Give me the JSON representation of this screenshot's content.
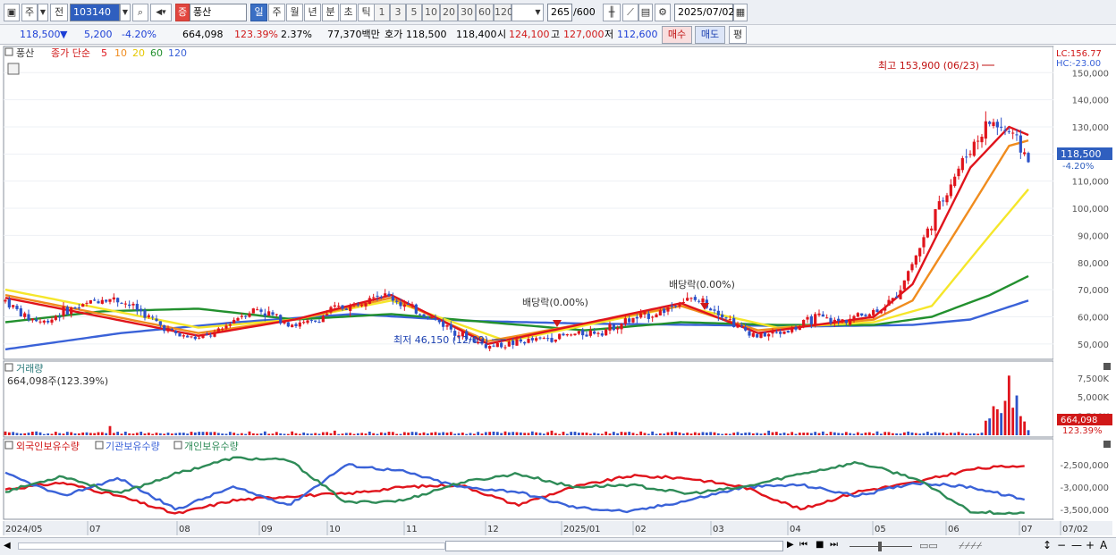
{
  "toolbar": {
    "type_label": "주",
    "all_label": "전",
    "code": "103140",
    "stock_badge": "증",
    "stock_name": "풍산",
    "periods": [
      "일",
      "주",
      "월",
      "년",
      "분",
      "초",
      "틱"
    ],
    "minute_units": [
      "1",
      "3",
      "5",
      "10",
      "20",
      "30",
      "60",
      "120"
    ],
    "count": "265",
    "count_total": "/600",
    "date": "2025/07/02"
  },
  "quote": {
    "price": "118,500",
    "change_arrow": "▼",
    "change": "5,200",
    "change_pct": "-4.20%",
    "volume": "664,098",
    "volume_ratio": "123.39%",
    "turnover": "2.37%",
    "amount": "77,370백만",
    "bid_label": "호가",
    "ask_price": "118,500",
    "bid_price": "118,400",
    "open_label": "시",
    "open": "124,100",
    "high_label": "고",
    "high": "127,000",
    "low_label": "저",
    "low": "112,600",
    "buy_label": "매수",
    "sell_label": "매도",
    "eval_label": "평"
  },
  "price_panel": {
    "stock_tag": "풍산",
    "ma_title": "종가 단순",
    "ma_periods": [
      "5",
      "10",
      "20",
      "60",
      "120"
    ],
    "lc_label": "LC:156.77",
    "hc_label": "HC:-23.00",
    "current_price_label": "118,500",
    "current_change_label": "-4.20%",
    "annotation_high": "최고 153,900 (06/23)",
    "annotation_low": "최저 46,150 (12/09)",
    "annotation_div1": "배당락(0.00%)",
    "annotation_div2": "배당락(0.00%)"
  },
  "volume_panel": {
    "title": "거래량",
    "value_label": "664,098주(123.39%)",
    "current_label": "664,098",
    "ratio_label": "123.39%"
  },
  "holding_panel": {
    "series_labels": [
      "외국인보유수량",
      "기관보유수량",
      "개인보유수량"
    ]
  },
  "date_axis": [
    "2024/05",
    "07",
    "08",
    "09",
    "10",
    "11",
    "12",
    "2025/01",
    "02",
    "03",
    "04",
    "05",
    "06",
    "07",
    "07/02"
  ],
  "colors": {
    "ma5": "#e0141c",
    "ma10": "#f08c1e",
    "ma20": "#f5e62a",
    "ma60": "#22902e",
    "ma120": "#3a62d8",
    "up": "#e0141c",
    "down": "#2c52c8",
    "foreign": "#e0141c",
    "institution": "#3a62d8",
    "individual": "#2e8b57"
  },
  "chart_data": [
    {
      "type": "candlestick",
      "title": "풍산",
      "x": [
        "2024/05",
        "07",
        "08",
        "09",
        "10",
        "11",
        "12",
        "2025/01",
        "02",
        "03",
        "04",
        "05",
        "06",
        "07"
      ],
      "y_ticks": [
        50000,
        60000,
        70000,
        80000,
        90000,
        100000,
        110000,
        120000,
        130000,
        140000,
        150000
      ],
      "ylim": [
        45000,
        157000
      ],
      "close_path": [
        [
          0,
          66000
        ],
        [
          1,
          60000
        ],
        [
          2,
          58000
        ],
        [
          3,
          62000
        ],
        [
          4,
          64000
        ],
        [
          5,
          67000
        ],
        [
          6,
          66000
        ],
        [
          7,
          62000
        ],
        [
          8,
          57000
        ],
        [
          9,
          53000
        ],
        [
          10,
          52000
        ],
        [
          11,
          54000
        ],
        [
          12,
          60000
        ],
        [
          13,
          63000
        ],
        [
          14,
          60000
        ],
        [
          15,
          57000
        ],
        [
          16,
          58000
        ],
        [
          17,
          63000
        ],
        [
          18,
          64000
        ],
        [
          19,
          69000
        ],
        [
          20,
          67000
        ],
        [
          21,
          63000
        ],
        [
          22,
          60000
        ],
        [
          23,
          56000
        ],
        [
          24,
          52000
        ],
        [
          25,
          49000
        ],
        [
          26,
          50000
        ],
        [
          27,
          51000
        ],
        [
          28,
          52000
        ],
        [
          29,
          53000
        ],
        [
          30,
          54000
        ],
        [
          31,
          55000
        ],
        [
          32,
          58000
        ],
        [
          33,
          60000
        ],
        [
          34,
          62000
        ],
        [
          35,
          66000
        ],
        [
          36,
          66000
        ],
        [
          37,
          62000
        ],
        [
          38,
          56000
        ],
        [
          39,
          53000
        ],
        [
          40,
          54000
        ],
        [
          41,
          56000
        ],
        [
          42,
          60000
        ],
        [
          43,
          58000
        ],
        [
          44,
          60000
        ],
        [
          45,
          62000
        ],
        [
          46,
          66000
        ],
        [
          47,
          80000
        ],
        [
          48,
          95000
        ],
        [
          49,
          110000
        ],
        [
          50,
          122000
        ],
        [
          51,
          132000
        ],
        [
          52,
          128000
        ],
        [
          53,
          118500
        ]
      ],
      "ma": {
        "5": [
          [
            0,
            67000
          ],
          [
            10,
            53000
          ],
          [
            15,
            59000
          ],
          [
            20,
            68000
          ],
          [
            25,
            50000
          ],
          [
            35,
            65000
          ],
          [
            39,
            54000
          ],
          [
            45,
            60000
          ],
          [
            47,
            72000
          ],
          [
            50,
            115000
          ],
          [
            52,
            130000
          ],
          [
            53,
            127000
          ]
        ],
        "10": [
          [
            0,
            68000
          ],
          [
            10,
            54000
          ],
          [
            15,
            59000
          ],
          [
            20,
            67000
          ],
          [
            25,
            51000
          ],
          [
            35,
            64000
          ],
          [
            39,
            55000
          ],
          [
            45,
            59000
          ],
          [
            47,
            66000
          ],
          [
            50,
            100000
          ],
          [
            52,
            123000
          ],
          [
            53,
            125000
          ]
        ],
        "20": [
          [
            0,
            70000
          ],
          [
            10,
            56000
          ],
          [
            15,
            59000
          ],
          [
            20,
            66000
          ],
          [
            26,
            51000
          ],
          [
            35,
            64000
          ],
          [
            40,
            56000
          ],
          [
            45,
            58000
          ],
          [
            48,
            64000
          ],
          [
            51,
            90000
          ],
          [
            53,
            107000
          ]
        ],
        "60": [
          [
            0,
            58000
          ],
          [
            5,
            62000
          ],
          [
            10,
            63000
          ],
          [
            15,
            59000
          ],
          [
            20,
            61000
          ],
          [
            25,
            58000
          ],
          [
            30,
            55000
          ],
          [
            35,
            58000
          ],
          [
            40,
            57000
          ],
          [
            45,
            57000
          ],
          [
            48,
            60000
          ],
          [
            51,
            68000
          ],
          [
            53,
            75000
          ]
        ],
        "120": [
          [
            0,
            48000
          ],
          [
            6,
            54000
          ],
          [
            12,
            58000
          ],
          [
            18,
            61000
          ],
          [
            24,
            58500
          ],
          [
            30,
            57500
          ],
          [
            36,
            57000
          ],
          [
            42,
            56500
          ],
          [
            47,
            57000
          ],
          [
            50,
            59000
          ],
          [
            53,
            66000
          ]
        ]
      },
      "markers": {
        "high": 153900,
        "low": 46150
      }
    },
    {
      "type": "bar",
      "title": "거래량",
      "y_ticks": [
        2500000,
        5000000,
        7500000
      ],
      "ylim": [
        0,
        9000000
      ],
      "values_sample": [
        400000,
        300000,
        1200000,
        250000,
        350000,
        280000,
        500000,
        300000,
        260000,
        450000,
        7800000,
        5200000,
        3800000,
        2200000,
        664098
      ]
    },
    {
      "type": "line",
      "title": "보유수량",
      "y_ticks": [
        -2500000,
        -3000000,
        -3500000
      ],
      "ylim": [
        -3700000,
        -2200000
      ],
      "series": [
        {
          "name": "외국인보유수량",
          "values": [
            -3050000,
            -2900000,
            -3200000,
            -3600000,
            -3300000,
            -3200000,
            -3150000,
            -3000000,
            -2950000,
            -3400000,
            -3000000,
            -2750000,
            -2800000,
            -3000000,
            -3500000,
            -3100000,
            -2900000,
            -2600000,
            -2500000
          ]
        },
        {
          "name": "기관보유수량",
          "values": [
            -2700000,
            -3200000,
            -2800000,
            -3500000,
            -3000000,
            -3400000,
            -2500000,
            -2650000,
            -3000000,
            -3100000,
            -3450000,
            -3550000,
            -3300000,
            -3000000,
            -2950000,
            -3200000,
            -2900000,
            -3000000,
            -3300000
          ]
        },
        {
          "name": "개인보유수량",
          "values": [
            -3100000,
            -2750000,
            -3150000,
            -2700000,
            -2350000,
            -2400000,
            -3350000,
            -3300000,
            -2900000,
            -2700000,
            -3000000,
            -2950000,
            -3150000,
            -3000000,
            -2700000,
            -2450000,
            -2800000,
            -3550000,
            -3600000
          ]
        }
      ]
    }
  ]
}
